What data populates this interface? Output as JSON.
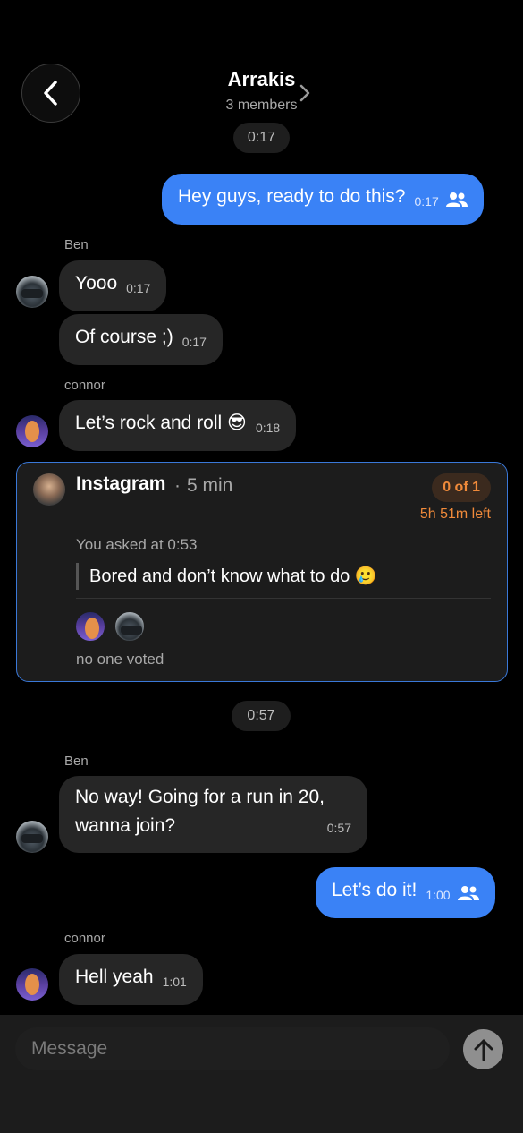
{
  "header": {
    "title": "Arrakis",
    "subtitle": "3 members",
    "back_icon": "chevron-left-icon",
    "details_icon": "chevron-right-icon"
  },
  "timestamps": [
    "0:17",
    "0:57"
  ],
  "messages": [
    {
      "direction": "out",
      "text": "Hey guys, ready to do this?",
      "time": "0:17"
    },
    {
      "direction": "in",
      "sender": "Ben",
      "text": "Yooo",
      "time": "0:17"
    },
    {
      "direction": "in",
      "text": "Of course ;)",
      "time": "0:17"
    },
    {
      "direction": "in",
      "sender": "connor",
      "text": "Let’s rock and roll 😎",
      "time": "0:18"
    },
    {
      "direction": "in",
      "sender": "Ben",
      "text_line1": "No way! Going for a run in 20,",
      "text_line2": "wanna join?",
      "time": "0:57"
    },
    {
      "direction": "out",
      "text": "Let’s do it!",
      "time": "1:00"
    },
    {
      "direction": "in",
      "sender": "connor",
      "text": "Hell yeah",
      "time": "1:01"
    }
  ],
  "poll": {
    "source": "Instagram",
    "separator": "·",
    "age": "5 min",
    "badge": "0 of 1",
    "time_left": "5h 51m left",
    "asked": "You asked at 0:53",
    "question": "Bored and don’t know what to do 🥲",
    "votes_text": "no one voted"
  },
  "composer": {
    "placeholder": "Message",
    "send_icon": "arrow-up-icon"
  },
  "colors": {
    "background": "#000000",
    "outgoing_bubble": "#3a82f6",
    "incoming_bubble": "#262626",
    "poll_border": "#3a78d8",
    "accent_orange": "#f08a3a"
  }
}
